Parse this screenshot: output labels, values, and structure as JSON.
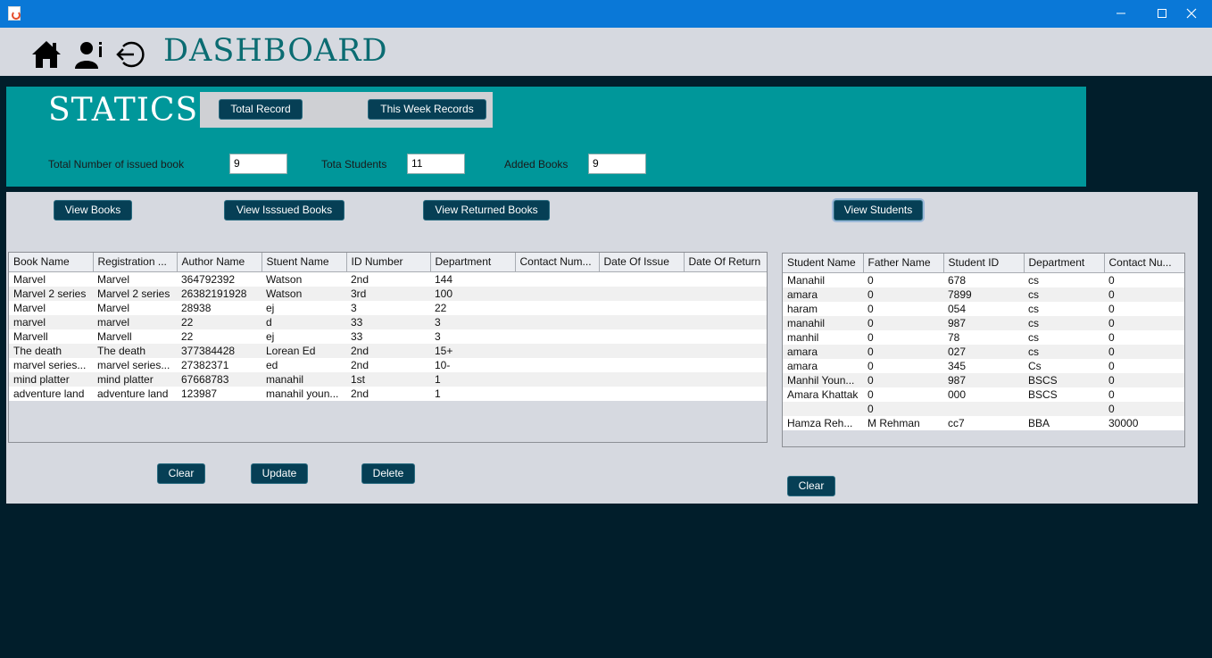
{
  "header": {
    "title": "DASHBOARD",
    "icons": [
      "home-icon",
      "user-info-icon",
      "logout-icon"
    ]
  },
  "statics": {
    "title": "STATICS",
    "total_record_btn": "Total Record",
    "week_records_btn": "This Week Records",
    "issued_label": "Total Number of issued book",
    "issued_value": "9",
    "students_label": "Tota Students",
    "students_value": "11",
    "added_label": "Added Books",
    "added_value": "9"
  },
  "nav": {
    "view_books": "View Books",
    "view_issued": "View Isssued Books",
    "view_returned": "View Returned Books",
    "view_students": "View Students"
  },
  "books_table": {
    "columns": [
      "Book Name",
      "Registration ...",
      "Author Name",
      "Stuent Name",
      "ID Number",
      "Department",
      "Contact Num...",
      "Date Of Issue",
      "Date Of Return"
    ],
    "rows": [
      [
        "Marvel",
        "Marvel",
        "364792392",
        "Watson",
        "2nd",
        "144",
        "",
        "",
        ""
      ],
      [
        "Marvel 2 series",
        "Marvel 2 series",
        "26382191928",
        "Watson",
        "3rd",
        "100",
        "",
        "",
        ""
      ],
      [
        "Marvel",
        "Marvel",
        "28938",
        "ej",
        "3",
        "22",
        "",
        "",
        ""
      ],
      [
        "marvel",
        "marvel",
        "22",
        "d",
        "33",
        "3",
        "",
        "",
        ""
      ],
      [
        "Marvell",
        "Marvell",
        "22",
        "ej",
        "33",
        "3",
        "",
        "",
        ""
      ],
      [
        "The death",
        "The death",
        "377384428",
        "Lorean Ed",
        "2nd",
        "15+",
        "",
        "",
        ""
      ],
      [
        "marvel series...",
        "marvel series...",
        "27382371",
        "ed",
        "2nd",
        "10-",
        "",
        "",
        ""
      ],
      [
        "mind platter",
        "mind platter",
        "67668783",
        "manahil",
        "1st",
        "1",
        "",
        "",
        ""
      ],
      [
        "adventure land",
        "adventure land",
        "123987",
        "manahil youn...",
        "2nd",
        "1",
        "",
        "",
        ""
      ]
    ]
  },
  "students_table": {
    "columns": [
      "Student Name",
      "Father Name",
      "Student ID",
      "Department",
      "Contact Nu..."
    ],
    "rows": [
      [
        "Manahil",
        "0",
        "678",
        "cs",
        "0"
      ],
      [
        "amara",
        "0",
        "7899",
        "cs",
        "0"
      ],
      [
        "haram",
        "0",
        "054",
        "cs",
        "0"
      ],
      [
        "manahil",
        "0",
        "987",
        "cs",
        "0"
      ],
      [
        "manhil",
        "0",
        "78",
        "cs",
        "0"
      ],
      [
        "amara",
        "0",
        "027",
        "cs",
        "0"
      ],
      [
        "amara",
        "0",
        "345",
        "Cs",
        "0"
      ],
      [
        "Manhil Youn...",
        "0",
        "987",
        "BSCS",
        "0"
      ],
      [
        "Amara Khattak",
        "0",
        "000",
        "BSCS",
        "0"
      ],
      [
        "",
        "0",
        "",
        "",
        "0"
      ],
      [
        "Hamza Reh...",
        "M Rehman",
        "cc7",
        "BBA",
        "30000"
      ]
    ]
  },
  "actions": {
    "clear": "Clear",
    "update": "Update",
    "delete": "Delete",
    "clear_students": "Clear"
  }
}
